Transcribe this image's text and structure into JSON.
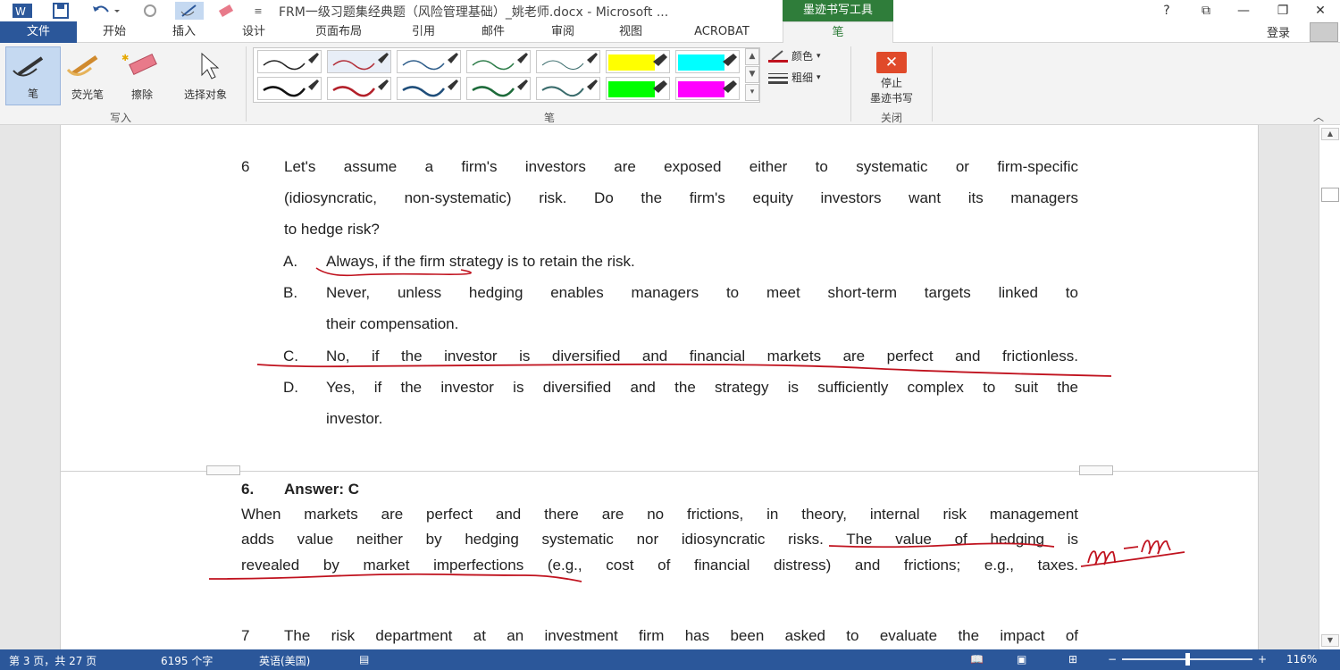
{
  "title_bar": {
    "title": "FRM一级习题集经典题（风险管理基础）_姚老师.docx - Microsoft ...",
    "context_tab": "墨迹书写工具",
    "help": "?",
    "restore": "⧉",
    "minimize": "—",
    "maximize": "❐",
    "close": "✕"
  },
  "tabs": {
    "file": "文件",
    "items": [
      "开始",
      "插入",
      "设计",
      "页面布局",
      "引用",
      "邮件",
      "审阅",
      "视图",
      "ACROBAT"
    ],
    "active": "笔",
    "login": "登录"
  },
  "ribbon": {
    "write_group": {
      "label": "写入",
      "pen": "笔",
      "highlighter": "荧光笔",
      "eraser": "擦除",
      "select": "选择对象"
    },
    "pens_group": {
      "label": "笔",
      "color": "颜色",
      "thickness": "粗细"
    },
    "close_group": {
      "label": "关闭",
      "stop_line1": "停止",
      "stop_line2": "墨迹书写"
    }
  },
  "colors": {
    "accent_blue": "#2b579a",
    "ink_green": "#2f7d3a",
    "ink_red": "#c0121e"
  },
  "document": {
    "q6_number": "6",
    "q6_lines": [
      "Let's assume a firm's investors are exposed either to systematic or firm-specific",
      "(idiosyncratic, non-systematic) risk. Do the firm's equity investors want its managers",
      "to hedge risk?"
    ],
    "options": [
      {
        "letter": "A.",
        "lines": [
          "Always, if the firm strategy is to retain the risk."
        ]
      },
      {
        "letter": "B.",
        "lines": [
          "Never, unless hedging enables managers to meet short-term targets linked to",
          "their compensation."
        ]
      },
      {
        "letter": "C.",
        "lines": [
          "No, if the investor is diversified and financial markets are perfect and frictionless."
        ]
      },
      {
        "letter": "D.",
        "lines": [
          "Yes, if the investor is diversified and the strategy is sufficiently complex to suit the",
          "investor."
        ]
      }
    ],
    "answer_number": "6.",
    "answer_label": "Answer: C",
    "answer_lines": [
      "When markets are perfect and there are no frictions, in theory, internal risk management",
      "adds value neither by hedging systematic nor idiosyncratic risks. The value of hedging is",
      "revealed by market imperfections (e.g., cost of financial distress) and frictions; e.g., taxes."
    ],
    "handwritten_note": "m-m",
    "q7_number": "7",
    "q7_line": "The risk department at an investment firm has been asked to evaluate the impact of"
  },
  "status_bar": {
    "page": "第 3 页，共 27 页",
    "words": "6195 个字",
    "language": "英语(美国)",
    "zoom": "116%"
  }
}
